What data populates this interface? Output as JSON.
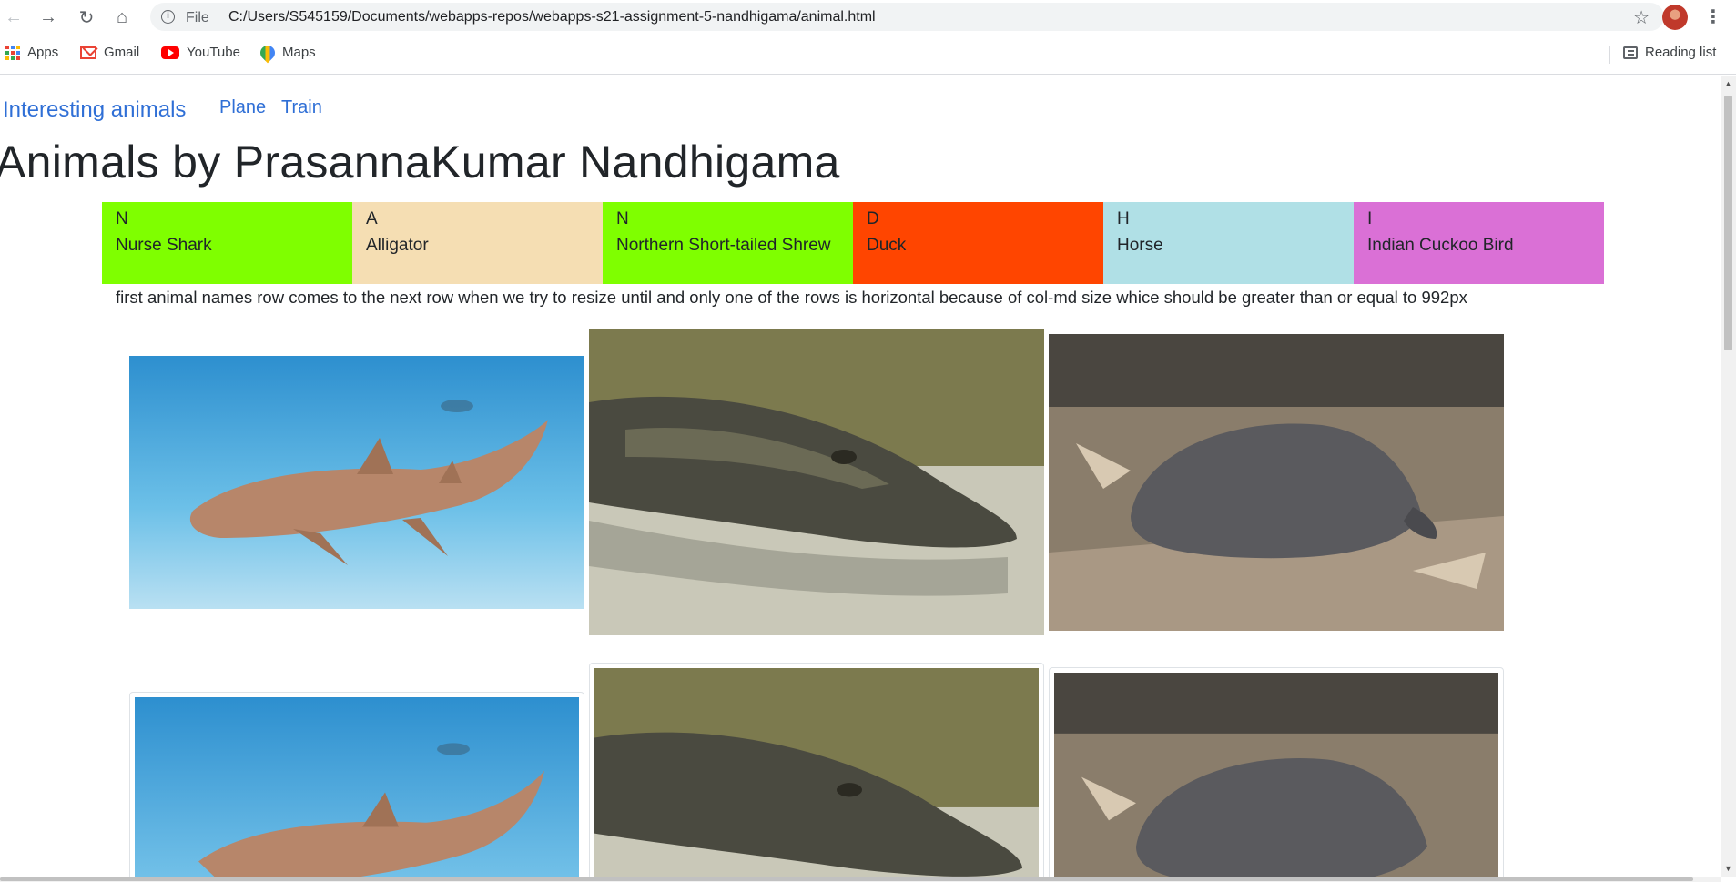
{
  "browser": {
    "address_scheme": "File",
    "address_url": "C:/Users/S545159/Documents/webapps-repos/webapps-s21-assignment-5-nandhigama/animal.html",
    "bookmarks": [
      "Apps",
      "Gmail",
      "YouTube",
      "Maps"
    ],
    "reading_list": "Reading list"
  },
  "nav": {
    "brand": "Interesting animals",
    "links": [
      "Plane",
      "Train"
    ]
  },
  "page": {
    "title": "Animals by PrasannaKumar Nandhigama",
    "note": "first animal names row comes to the next row when we try to resize until and only one of the rows is horizontal because of col-md size whice should be greater than or equal to 992px"
  },
  "animals": [
    {
      "letter": "N",
      "name": "Nurse Shark",
      "color": "#7fff00"
    },
    {
      "letter": "A",
      "name": "Alligator",
      "color": "#f5deb3"
    },
    {
      "letter": "N",
      "name": "Northern Short-tailed Shrew",
      "color": "#7fff00"
    },
    {
      "letter": "D",
      "name": "Duck",
      "color": "#ff4500"
    },
    {
      "letter": "H",
      "name": "Horse",
      "color": "#b0e0e6"
    },
    {
      "letter": "I",
      "name": "Indian Cuckoo Bird",
      "color": "#da70d6"
    }
  ],
  "images": {
    "row1": [
      "nurse-shark-photo",
      "alligator-photo",
      "shrew-photo"
    ],
    "row2": [
      "nurse-shark-thumbnail",
      "alligator-thumbnail",
      "shrew-thumbnail"
    ]
  }
}
